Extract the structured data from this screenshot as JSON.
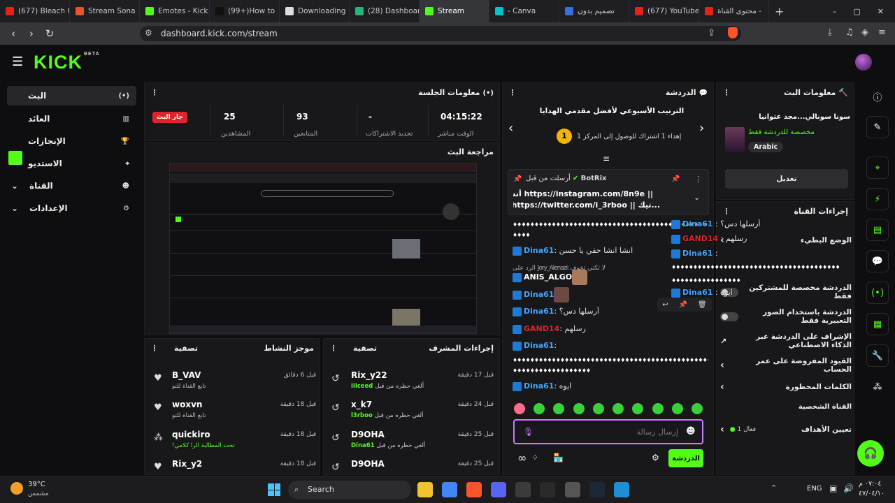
{
  "browser": {
    "tabs": [
      {
        "label": "(677) Bleach O",
        "color": "#e62117"
      },
      {
        "label": "Stream Sona",
        "color": "#e8552a"
      },
      {
        "label": "Emotes - Kick",
        "color": "#53fc18"
      },
      {
        "label": "(99+)How to ",
        "color": "#111111"
      },
      {
        "label": "Downloading",
        "color": "#dddddd"
      },
      {
        "label": "(28) Dashboar",
        "color": "#2ab27b"
      },
      {
        "label": "Stream",
        "color": "#53fc18"
      },
      {
        "label": "- Canva",
        "color": "#00c4cc"
      },
      {
        "label": "تصميم بدون",
        "color": "#3b6fe0"
      },
      {
        "label": "(677) YouTube",
        "color": "#e62117"
      },
      {
        "label": "محتوى القناة -",
        "color": "#e62117"
      }
    ],
    "url": "dashboard.kick.com/stream"
  },
  "app": {
    "logo": "KICK",
    "logo_sup": "BETA",
    "nav": [
      {
        "label": "البث",
        "icon": "(•)"
      },
      {
        "label": "العائد",
        "icon": "▥"
      },
      {
        "label": "الإنجازات",
        "icon": "🏆"
      },
      {
        "label": "الاستديو",
        "icon": "⌖"
      },
      {
        "label": "القناة",
        "icon": "☻"
      },
      {
        "label": "الإعدادات",
        "icon": "⚙"
      }
    ]
  },
  "session": {
    "title": "معلومات الجلسة",
    "live_badge": "جار البث",
    "stats": [
      {
        "value": "25",
        "label": "المشاهدين"
      },
      {
        "value": "93",
        "label": "المتابعين"
      },
      {
        "value": "-",
        "label": "تحديد الاشتراكات"
      },
      {
        "value": "04:15:22",
        "label": "الوقت مباشر"
      }
    ]
  },
  "preview": {
    "title": "مراجعة البث"
  },
  "activity": {
    "title": "موجز النشاط",
    "filter": "تصفية",
    "items": [
      {
        "name": "B_VAV",
        "sub": "تابع القناة للتو",
        "time": "قبل 6 دقائق"
      },
      {
        "name": "woxvn",
        "sub": "تابع القناة للتو",
        "time": "قبل 18 دقيقة"
      },
      {
        "name": "quickiro",
        "sub": "!تحت المطالبة الرا كلامي",
        "time": "قبل 18 دقيقة"
      },
      {
        "name": "Rix_y2",
        "sub": "",
        "time": "قبل 18 دقيقة"
      }
    ]
  },
  "mod": {
    "title": "إجراءات المشرف",
    "filter": "تصفية",
    "items": [
      {
        "name": "Rix_y22",
        "prefix": "ألغي حظره من قبل",
        "by": "iiiceed",
        "time": "قبل 17 دقيقة"
      },
      {
        "name": "x_k7",
        "prefix": "ألغي حظره من قبل",
        "by": "l3rboo",
        "time": "قبل 24 دقيقة"
      },
      {
        "name": "D9OHA",
        "prefix": "ألغي حظره من قبل",
        "by": "Dina61",
        "time": "قبل 25 دقيقة"
      },
      {
        "name": "D9OHA",
        "prefix": "",
        "by": "",
        "time": "قبل 25 دقيقة"
      }
    ]
  },
  "chat": {
    "title": "الدردشة",
    "leaderboard_title": "الترتيب الأسبوعي لأفضل مقدمي الهدايا",
    "leaderboard_line": "إهداء 1 اشتراك للوصول إلى المركز 1",
    "leaderboard_rank": "1",
    "pinned_label": "أرسلت من قبل",
    "pinned_user": "BotRix",
    "pinned_line1": "|| https://instagram.com/8n9e أنستا",
    "pinned_line2": "...تيك || https://twitter.com/i_3rboo تويتر",
    "messages": [
      {
        "user": "",
        "text": "♦♦♦♦♦♦♦♦♦♦♦♦♦♦♦♦♦♦♦♦♦♦♦♦♦♦♦♦♦♦♦♦♦♦♦♦♦♦♦♦♦♦♦♦♦♦♦♦♦♦♦♦",
        "color": "#ffffff"
      },
      {
        "user": "",
        "text": "♦♦♦♦",
        "color": "#ffffff"
      },
      {
        "user": "Dina61",
        "text": "انشا انشا حقي يا حسن",
        "color": "#3ea6ff"
      },
      {
        "user": "",
        "text": "الرد على Jory_Alenazi: لا تكتي تخوف",
        "color": "#aaaaaa"
      },
      {
        "user": "ANIS_ALGO",
        "text": "",
        "color": "#ffffff"
      },
      {
        "user": "Dina61",
        "text": "",
        "color": "#3ea6ff"
      },
      {
        "user": "Dina61",
        "text": "أرسلها دس؟",
        "color": "#3ea6ff"
      },
      {
        "user": "GAND14",
        "text": "رسلهم",
        "color": "#e0242b"
      },
      {
        "user": "Dina61",
        "text": "",
        "color": "#3ea6ff"
      },
      {
        "user": "",
        "text": "♦♦♦♦♦♦♦♦♦♦♦♦♦♦♦♦♦♦♦♦♦♦♦♦♦♦♦♦♦♦♦♦♦♦♦♦♦♦♦♦♦♦♦♦♦♦♦♦♦♦♦♦♦",
        "color": "#ffffff"
      },
      {
        "user": "",
        "text": "♦♦♦♦♦♦♦♦♦♦♦♦♦♦♦♦♦♦",
        "color": "#ffffff"
      },
      {
        "user": "Dina61",
        "text": "ايوه",
        "color": "#3ea6ff"
      }
    ],
    "input_placeholder": "إرسال رسالة",
    "send_label": "الدردشة"
  },
  "stream_info": {
    "title": "معلومات البث",
    "stream_title": "سونا سونالي...مجد عتوانيا",
    "category": "مخصصة للدردشة فقط",
    "language": "Arabic",
    "edit_label": "تعديل"
  },
  "channel_actions": {
    "title": "إجراءات القناة",
    "overlay_lines": [
      {
        "user": "Dina61",
        "text": "أرسلها دس؟",
        "color": "#3ea6ff"
      },
      {
        "user": "GAND14",
        "text": "رسلهم",
        "color": "#e0242b"
      },
      {
        "user": "Dina61",
        "text": "",
        "color": "#3ea6ff"
      },
      {
        "user": "",
        "text": "♦♦♦♦♦♦♦♦♦♦♦♦♦♦♦♦♦♦♦♦♦♦♦♦♦♦♦♦♦♦♦♦♦♦♦♦♦♦♦",
        "color": "#ffffff"
      },
      {
        "user": "",
        "text": "♦♦♦♦♦♦♦♦♦♦♦♦♦♦♦♦",
        "color": "#ffffff"
      },
      {
        "user": "Dina61",
        "text": "ايوه",
        "color": "#3ea6ff"
      }
    ],
    "rows": [
      {
        "label": "الوضع البطيء",
        "type": "chevron"
      },
      {
        "label": "الدردشة مخصصة للمشتركين فقط",
        "type": "toggle"
      },
      {
        "label": "الدردشة باستخدام الصور التعبيرية فقط",
        "type": "toggle"
      },
      {
        "label": "الإشراف على الدردشة عبر الذكاء الاصطناعي",
        "type": "link"
      },
      {
        "label": "القيود المفروضة على عمر الحساب",
        "type": "chevron"
      },
      {
        "label": "الكلمات المحظورة",
        "type": "chevron"
      }
    ],
    "personal_title": "القناة الشخصية",
    "goals_label": "تعيين الأهداف",
    "goals_value": "فعال 1"
  },
  "taskbar": {
    "temp": "39°C",
    "weather": "مشمس",
    "search": "Search",
    "lang": "ENG",
    "time": "٠٧:٠٤ م",
    "date": "٤٧/٠٤/١٠"
  }
}
